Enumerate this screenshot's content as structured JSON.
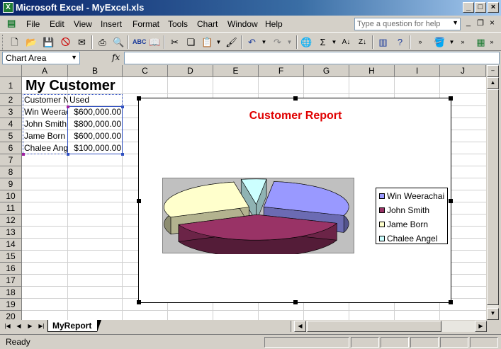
{
  "window": {
    "title": "Microsoft Excel - MyExcel.xls"
  },
  "menu": [
    "File",
    "Edit",
    "View",
    "Insert",
    "Format",
    "Tools",
    "Chart",
    "Window",
    "Help"
  ],
  "help_box": {
    "placeholder": "Type a question for help"
  },
  "name_box": {
    "value": "Chart Area"
  },
  "formula_bar": {
    "fx_label": "fx",
    "value": ""
  },
  "columns": [
    "A",
    "B",
    "C",
    "D",
    "E",
    "F",
    "G",
    "H",
    "I",
    "J"
  ],
  "rows": [
    "1",
    "2",
    "3",
    "4",
    "5",
    "6",
    "7",
    "8",
    "9",
    "10",
    "11",
    "12",
    "13",
    "14",
    "15",
    "16",
    "17",
    "18",
    "19",
    "20"
  ],
  "cells": {
    "A1": "My Customer",
    "A2": "Customer N",
    "B2": "Used",
    "A3": "Win Weerachai",
    "B3": "$600,000.00",
    "A4": "John Smith",
    "B4": "$800,000.00",
    "A5": "Jame Born",
    "B5": "$600,000.00",
    "A6": "Chalee Angel",
    "B6": "$100,000.00"
  },
  "chart_data": {
    "type": "pie",
    "title": "Customer Report",
    "categories": [
      "Win Weerachai",
      "John Smith",
      "Jame Born",
      "Chalee Angel"
    ],
    "values": [
      600000,
      800000,
      600000,
      100000
    ],
    "colors": [
      "#9999ff",
      "#993366",
      "#ffffcc",
      "#ccffff"
    ],
    "exploded": true,
    "style": "3d",
    "legend": "right"
  },
  "sheet_tab": {
    "label": "MyReport"
  },
  "status": {
    "text": "Ready"
  }
}
